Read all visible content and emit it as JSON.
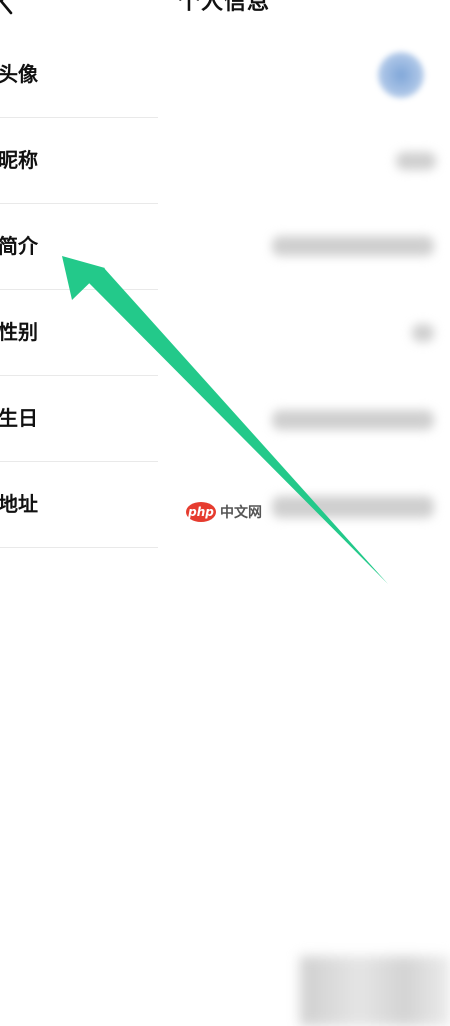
{
  "header": {
    "title": "个人信息",
    "back_icon": "chevron-left-icon"
  },
  "rows": [
    {
      "label": "头像"
    },
    {
      "label": "昵称"
    },
    {
      "label": "简介"
    },
    {
      "label": "性别"
    },
    {
      "label": "生日"
    },
    {
      "label": "地址"
    }
  ],
  "annotation": {
    "arrow_color": "#23c98a",
    "arrow_target": "简介"
  },
  "watermark": {
    "logo": "php",
    "text": "中文网",
    "logo_color": "#e63c2f"
  }
}
